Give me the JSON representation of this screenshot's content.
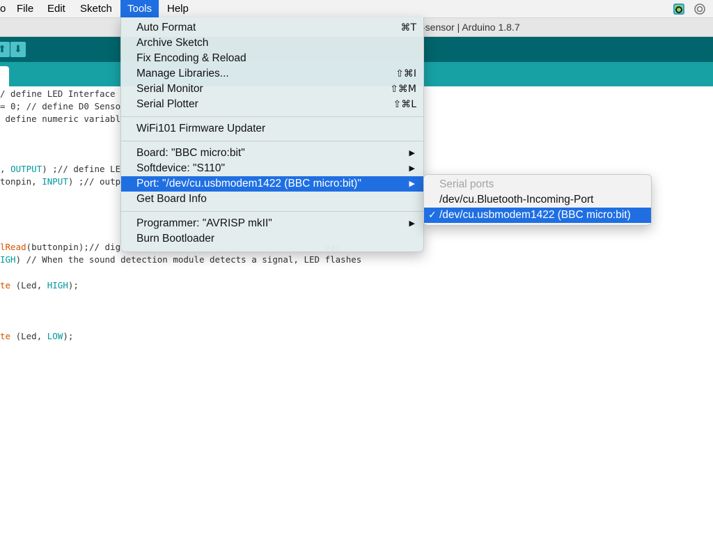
{
  "menubar": {
    "app_fragment": "o",
    "items": [
      "File",
      "Edit",
      "Sketch",
      "Tools",
      "Help"
    ]
  },
  "window": {
    "title_fragment": "-sensor | Arduino 1.8.7"
  },
  "toolbar": {
    "buttons": [
      {
        "icon": "open-icon",
        "glyph": "⬆"
      },
      {
        "icon": "save-icon",
        "glyph": "⬇"
      }
    ]
  },
  "editor": {
    "lines": [
      {
        "segments": [
          {
            "t": "/ define LED Interface"
          }
        ]
      },
      {
        "segments": [
          {
            "t": "= 0; // define D0 Senso"
          }
        ]
      },
      {
        "segments": [
          {
            "t": " define numeric variabl"
          }
        ]
      },
      {
        "segments": [
          {
            "t": ""
          }
        ]
      },
      {
        "segments": [
          {
            "t": ""
          }
        ]
      },
      {
        "segments": [
          {
            "t": ""
          }
        ]
      },
      {
        "segments": [
          {
            "t": ", "
          },
          {
            "t": "OUTPUT",
            "c": "teal"
          },
          {
            "t": ") ;// define LE"
          }
        ]
      },
      {
        "segments": [
          {
            "t": "tonpin, "
          },
          {
            "t": "INPUT",
            "c": "teal"
          },
          {
            "t": ") ;// outp"
          }
        ]
      },
      {
        "segments": [
          {
            "t": ""
          }
        ]
      },
      {
        "segments": [
          {
            "t": ""
          }
        ]
      },
      {
        "segments": [
          {
            "t": ""
          }
        ]
      },
      {
        "segments": [
          {
            "t": ""
          }
        ]
      },
      {
        "segments": [
          {
            "t": "lRead",
            "c": "orange"
          },
          {
            "t": "(buttonpin);// dig"
          },
          {
            "t": "                                       "
          },
          {
            "t": "val"
          }
        ]
      },
      {
        "segments": [
          {
            "t": "IGH",
            "c": "teal"
          },
          {
            "t": ") // When the sound detection module detects a signal, LED flashes"
          }
        ]
      },
      {
        "segments": [
          {
            "t": ""
          }
        ]
      },
      {
        "segments": [
          {
            "t": "te",
            "c": "orange"
          },
          {
            "t": " (Led, "
          },
          {
            "t": "HIGH",
            "c": "teal"
          },
          {
            "t": ");"
          }
        ]
      },
      {
        "segments": [
          {
            "t": ""
          }
        ]
      },
      {
        "segments": [
          {
            "t": ""
          }
        ]
      },
      {
        "segments": [
          {
            "t": ""
          }
        ]
      },
      {
        "segments": [
          {
            "t": "te",
            "c": "orange"
          },
          {
            "t": " (Led, "
          },
          {
            "t": "LOW",
            "c": "teal"
          },
          {
            "t": ");"
          }
        ]
      }
    ]
  },
  "tools_menu": {
    "groups": [
      [
        {
          "label": "Auto Format",
          "shortcut": "⌘T"
        },
        {
          "label": "Archive Sketch",
          "shortcut": ""
        },
        {
          "label": "Fix Encoding & Reload",
          "shortcut": ""
        },
        {
          "label": "Manage Libraries...",
          "shortcut": "⇧⌘I"
        },
        {
          "label": "Serial Monitor",
          "shortcut": "⇧⌘M"
        },
        {
          "label": "Serial Plotter",
          "shortcut": "⇧⌘L"
        }
      ],
      [
        {
          "label": "WiFi101 Firmware Updater",
          "shortcut": ""
        }
      ],
      [
        {
          "label": "Board: \"BBC micro:bit\"",
          "submenu": true
        },
        {
          "label": "Softdevice: \"S110\"",
          "submenu": true
        },
        {
          "label": "Port: \"/dev/cu.usbmodem1422 (BBC micro:bit)\"",
          "submenu": true,
          "highlighted": true
        },
        {
          "label": "Get Board Info",
          "shortcut": ""
        }
      ],
      [
        {
          "label": "Programmer: \"AVRISP mkII\"",
          "submenu": true
        },
        {
          "label": "Burn Bootloader",
          "shortcut": ""
        }
      ]
    ]
  },
  "port_submenu": {
    "header": "Serial ports",
    "items": [
      {
        "label": "/dev/cu.Bluetooth-Incoming-Port",
        "checked": false
      },
      {
        "label": "/dev/cu.usbmodem1422 (BBC micro:bit)",
        "checked": true
      }
    ],
    "check_glyph": "✓"
  },
  "colors": {
    "highlight": "#1f6fe3",
    "toolbar": "#00656c",
    "tabstrip": "#17a1a5"
  }
}
